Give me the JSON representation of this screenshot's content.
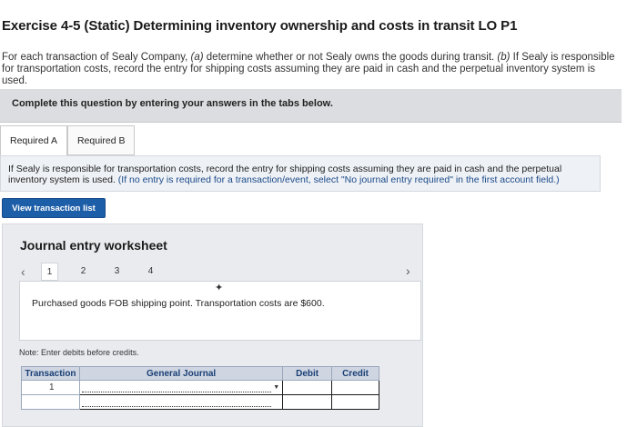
{
  "page": {
    "title": "Exercise 4-5 (Static) Determining inventory ownership and costs in transit LO P1",
    "intro_part1": "For each transaction of Sealy Company, ",
    "intro_a": "(a)",
    "intro_part2": " determine whether or not Sealy owns the goods during transit. ",
    "intro_b": "(b)",
    "intro_part3": " If Sealy is responsible for transportation costs, record the entry for shipping costs assuming they are paid in cash and the perpetual inventory system is used."
  },
  "instructions": {
    "text": "Complete this question by entering your answers in the tabs below."
  },
  "tabs": [
    {
      "label": "Required A"
    },
    {
      "label": "Required B"
    }
  ],
  "panel": {
    "text": "If Sealy is responsible for transportation costs, record the entry for shipping costs assuming they are paid in cash and the perpetual inventory system is used. ",
    "hint": "(If no entry is required for a transaction/event, select \"No journal entry required\" in the first account field.)"
  },
  "view_button": {
    "label": "View transaction list"
  },
  "worksheet": {
    "title": "Journal entry worksheet",
    "pages": [
      "1",
      "2",
      "3",
      "4"
    ],
    "prev_icon": "chevron-left-icon",
    "next_icon": "chevron-right-icon",
    "description": "Purchased goods FOB shipping point. Transportation costs are $600.",
    "note": "Note: Enter debits before credits."
  },
  "journal_table": {
    "headers": {
      "transaction": "Transaction",
      "general_journal": "General Journal",
      "debit": "Debit",
      "credit": "Credit"
    },
    "rows": [
      {
        "transaction": "1",
        "general_journal": "",
        "debit": "",
        "credit": ""
      },
      {
        "transaction": "",
        "general_journal": "",
        "debit": "",
        "credit": ""
      }
    ]
  }
}
